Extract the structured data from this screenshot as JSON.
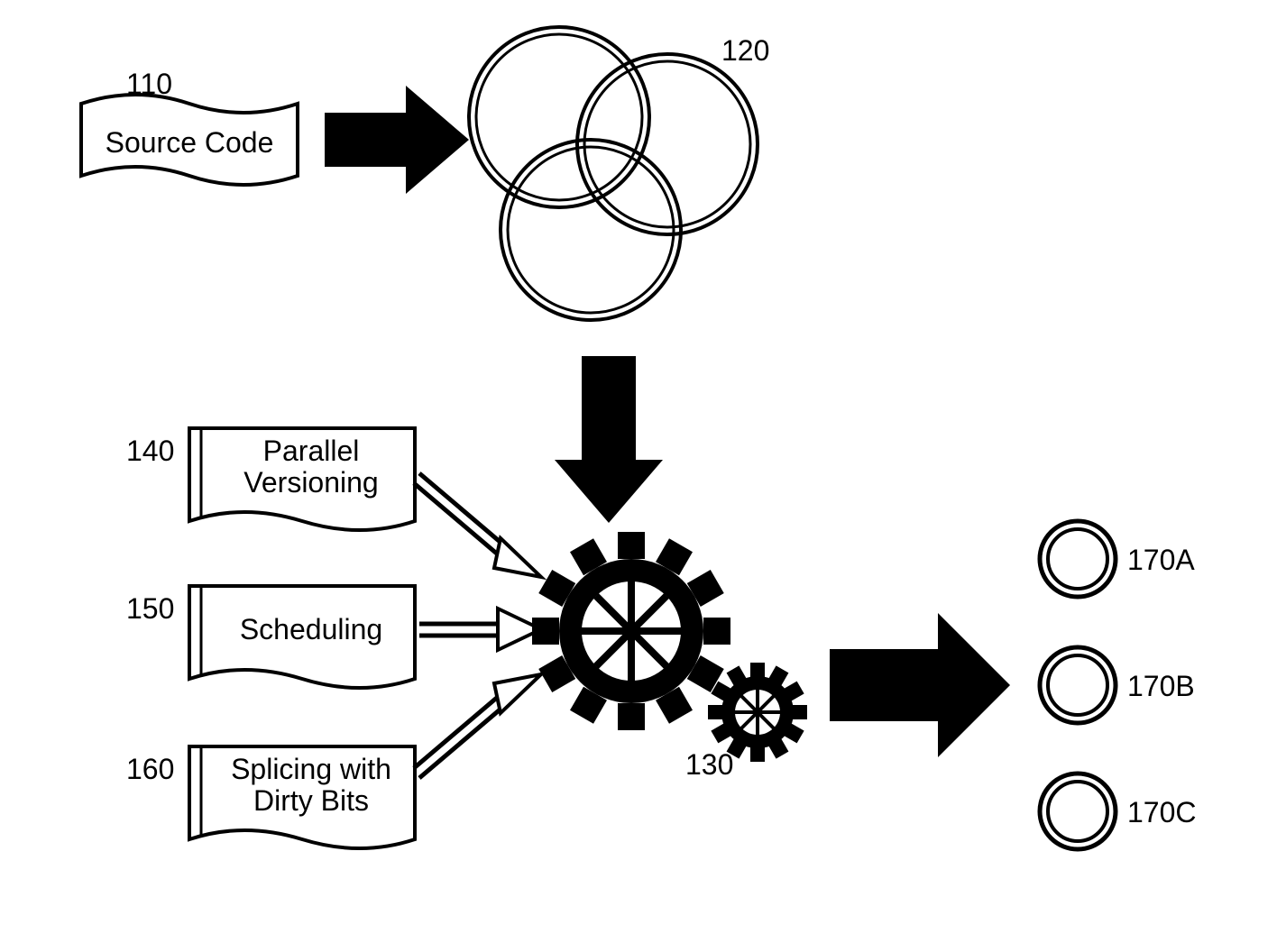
{
  "source_code": {
    "ref": "110",
    "label": "Source Code"
  },
  "venn": {
    "ref": "120"
  },
  "gears": {
    "ref": "130"
  },
  "inputs": [
    {
      "ref": "140",
      "label_line1": "Parallel",
      "label_line2": "Versioning"
    },
    {
      "ref": "150",
      "label_line1": "Scheduling",
      "label_line2": ""
    },
    {
      "ref": "160",
      "label_line1": "Splicing with",
      "label_line2": "Dirty Bits"
    }
  ],
  "outputs": [
    {
      "ref": "170A"
    },
    {
      "ref": "170B"
    },
    {
      "ref": "170C"
    }
  ]
}
